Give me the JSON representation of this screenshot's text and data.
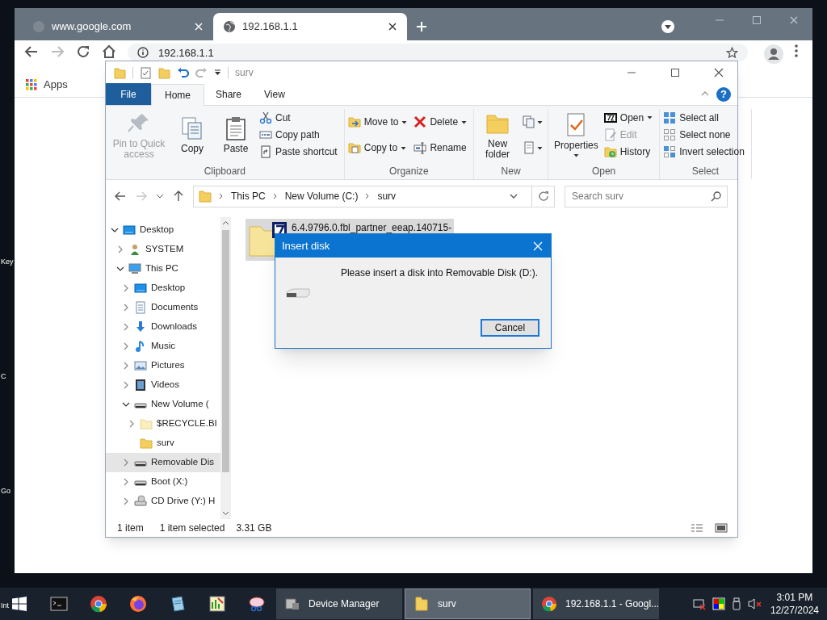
{
  "desktop_icons": [
    {
      "label": "Key"
    },
    {
      "label": "C"
    },
    {
      "label": "Go"
    },
    {
      "label": "Int"
    }
  ],
  "browser": {
    "tabs": [
      {
        "title": "www.google.com",
        "selected": false
      },
      {
        "title": "192.168.1.1",
        "selected": true
      }
    ],
    "address": "192.168.1.1",
    "bookmarks": [
      {
        "label": "Apps"
      }
    ]
  },
  "explorer": {
    "title": "surv",
    "ribbon_tabs": [
      {
        "label": "File",
        "kind": "file",
        "selected": false
      },
      {
        "label": "Home",
        "kind": "tab",
        "selected": true
      },
      {
        "label": "Share",
        "kind": "tab",
        "selected": false
      },
      {
        "label": "View",
        "kind": "tab",
        "selected": false
      }
    ],
    "help": "?",
    "ribbon_groups": [
      {
        "label": "Clipboard",
        "columns": [
          [
            {
              "label": "Pin to Quick access",
              "kind": "large",
              "disabled": true,
              "dropdown": false
            }
          ],
          [
            {
              "label": "Copy",
              "kind": "large",
              "disabled": false,
              "dropdown": false
            }
          ],
          [
            {
              "label": "Paste",
              "kind": "large",
              "disabled": false,
              "dropdown": false
            }
          ],
          [
            {
              "label": "Cut",
              "kind": "small",
              "disabled": false,
              "dropdown": false
            },
            {
              "label": "Copy path",
              "kind": "small",
              "disabled": false,
              "dropdown": false
            },
            {
              "label": "Paste shortcut",
              "kind": "small",
              "disabled": false,
              "dropdown": false
            }
          ]
        ]
      },
      {
        "label": "Organize",
        "columns": [
          [
            {
              "label": "Move to",
              "kind": "small",
              "disabled": false,
              "dropdown": true
            },
            {
              "label": "Copy to",
              "kind": "small",
              "disabled": false,
              "dropdown": true
            }
          ],
          [
            {
              "label": "Delete",
              "kind": "small",
              "disabled": false,
              "dropdown": true
            },
            {
              "label": "Rename",
              "kind": "small",
              "disabled": false,
              "dropdown": false
            }
          ]
        ]
      },
      {
        "label": "New",
        "columns": [
          [
            {
              "label": "New folder",
              "kind": "large",
              "disabled": false,
              "dropdown": false
            }
          ],
          [
            {
              "kind": "icon",
              "disabled": false,
              "dropdown": true
            },
            {
              "kind": "icon",
              "disabled": false,
              "dropdown": true
            }
          ]
        ]
      },
      {
        "label": "Open",
        "columns": [
          [
            {
              "label": "Properties",
              "kind": "large",
              "disabled": false,
              "dropdown": true
            }
          ],
          [
            {
              "label": "Open",
              "kind": "small",
              "disabled": false,
              "dropdown": true
            },
            {
              "label": "Edit",
              "kind": "small",
              "disabled": true,
              "dropdown": false
            },
            {
              "label": "History",
              "kind": "small",
              "disabled": false,
              "dropdown": false
            }
          ]
        ]
      },
      {
        "label": "Select",
        "columns": [
          [
            {
              "label": "Select all",
              "kind": "small",
              "disabled": false,
              "dropdown": false
            },
            {
              "label": "Select none",
              "kind": "small",
              "disabled": false,
              "dropdown": false
            },
            {
              "label": "Invert selection",
              "kind": "small",
              "disabled": false,
              "dropdown": false
            }
          ]
        ]
      }
    ],
    "breadcrumb": [
      "This PC",
      "New Volume (C:)",
      "surv"
    ],
    "search": {
      "placeholder": "Search surv"
    },
    "tree": [
      {
        "label": "Desktop",
        "kind": "branch",
        "expanded": true,
        "selected": false,
        "children": [
          {
            "label": "SYSTEM",
            "kind": "branch",
            "expanded": false,
            "selected": false
          },
          {
            "label": "This PC",
            "kind": "branch",
            "expanded": true,
            "selected": false,
            "children": [
              {
                "label": "Desktop",
                "kind": "branch",
                "expanded": false,
                "selected": false
              },
              {
                "label": "Documents",
                "kind": "branch",
                "expanded": false,
                "selected": false
              },
              {
                "label": "Downloads",
                "kind": "branch",
                "expanded": false,
                "selected": false
              },
              {
                "label": "Music",
                "kind": "branch",
                "expanded": false,
                "selected": false
              },
              {
                "label": "Pictures",
                "kind": "branch",
                "expanded": false,
                "selected": false
              },
              {
                "label": "Videos",
                "kind": "branch",
                "expanded": false,
                "selected": false
              },
              {
                "label": "New Volume (",
                "kind": "branch",
                "expanded": true,
                "selected": false,
                "children": [
                  {
                    "label": "$RECYCLE.BI",
                    "kind": "branch",
                    "expanded": false,
                    "selected": false
                  },
                  {
                    "label": "surv",
                    "kind": "leaf",
                    "selected": false
                  }
                ]
              },
              {
                "label": "Removable Dis",
                "kind": "branch",
                "expanded": false,
                "selected": true
              },
              {
                "label": "Boot (X:)",
                "kind": "branch",
                "expanded": false,
                "selected": false
              },
              {
                "label": "CD Drive (Y:) H",
                "kind": "branch",
                "expanded": false,
                "selected": false
              }
            ]
          }
        ]
      }
    ],
    "files": [
      {
        "name": "6.4.9796.0.fbl_partner_eeap.140715-",
        "selected": true
      }
    ],
    "status": [
      "1 item",
      "1 item selected",
      "3.31 GB"
    ]
  },
  "dialog": {
    "title": "Insert disk",
    "message": "Please insert a disk into Removable Disk (D:).",
    "buttons": [
      "Cancel"
    ]
  },
  "taskbar": {
    "windows": [
      {
        "label": "Device Manager",
        "selected": false
      },
      {
        "label": "surv",
        "selected": true
      },
      {
        "label": "192.168.1.1 - Googl...",
        "selected": false
      }
    ],
    "time": "3:01 PM",
    "date": "12/27/2024"
  }
}
